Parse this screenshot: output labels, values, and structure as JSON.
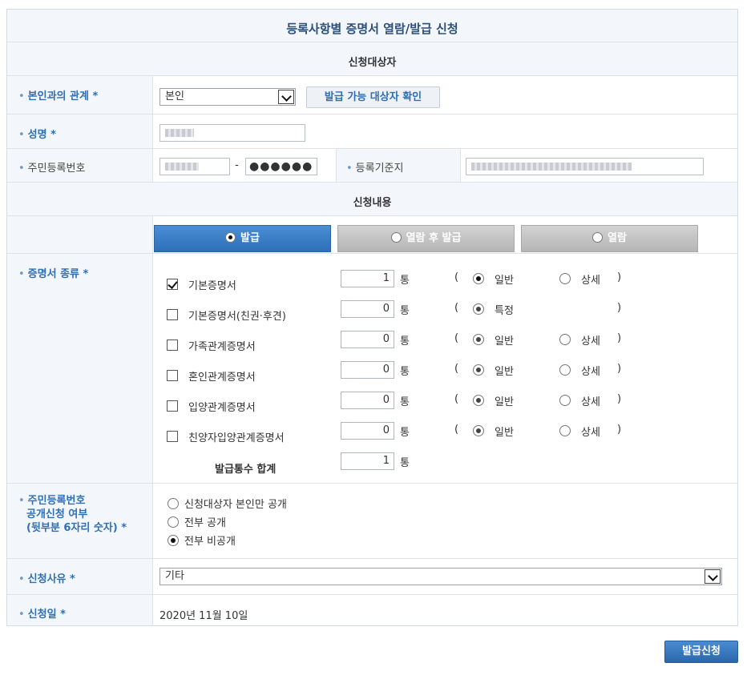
{
  "title": "등록사항별 증명서 열람/발급 신청",
  "section1": "신청대상자",
  "section2": "신청내용",
  "relation": {
    "label": "본인과의 관계",
    "required": "*",
    "value": "본인",
    "check_button": "발급 가능 대상자 확인"
  },
  "name": {
    "label": "성명",
    "required": "*"
  },
  "rrn": {
    "label": "주민등록번호",
    "dash": "-",
    "back_mask": "●●●●●●",
    "base_label": "등록기준지"
  },
  "tabs": [
    {
      "label": "발급",
      "selected": true
    },
    {
      "label": "열람 후 발급",
      "selected": false
    },
    {
      "label": "열람",
      "selected": false
    }
  ],
  "cert_types": {
    "label": "증명서 종류",
    "required": "*",
    "unit": "통",
    "open_paren": "(",
    "close_paren": ")",
    "items": [
      {
        "name": "기본증명서",
        "checked": true,
        "count": "1",
        "opt1": "일반",
        "opt2": "상세"
      },
      {
        "name": "기본증명서(친권·후견)",
        "checked": false,
        "count": "0",
        "opt1": "특정",
        "opt2": ""
      },
      {
        "name": "가족관계증명서",
        "checked": false,
        "count": "0",
        "opt1": "일반",
        "opt2": "상세"
      },
      {
        "name": "혼인관계증명서",
        "checked": false,
        "count": "0",
        "opt1": "일반",
        "opt2": "상세"
      },
      {
        "name": "입양관계증명서",
        "checked": false,
        "count": "0",
        "opt1": "일반",
        "opt2": "상세"
      },
      {
        "name": "친양자입양관계증명서",
        "checked": false,
        "count": "0",
        "opt1": "일반",
        "opt2": "상세"
      }
    ],
    "total_label": "발급통수 합계",
    "total_value": "1"
  },
  "disclosure": {
    "label_line1": "주민등록번호",
    "label_line2": "공개신청 여부",
    "label_line3": "(뒷부분 6자리 숫자)",
    "required": "*",
    "options": [
      {
        "label": "신청대상자 본인만 공개",
        "selected": false
      },
      {
        "label": "전부 공개",
        "selected": false
      },
      {
        "label": "전부 비공개",
        "selected": true
      }
    ]
  },
  "reason": {
    "label": "신청사유",
    "required": "*",
    "value": "기타"
  },
  "date": {
    "label": "신청일",
    "required": "*",
    "value": "2020년 11월 10일"
  },
  "submit": "발급신청",
  "colors": {
    "accent": "#2f6fb5",
    "button": "#3a7bc4",
    "label_bg": "#f3f6fa"
  }
}
